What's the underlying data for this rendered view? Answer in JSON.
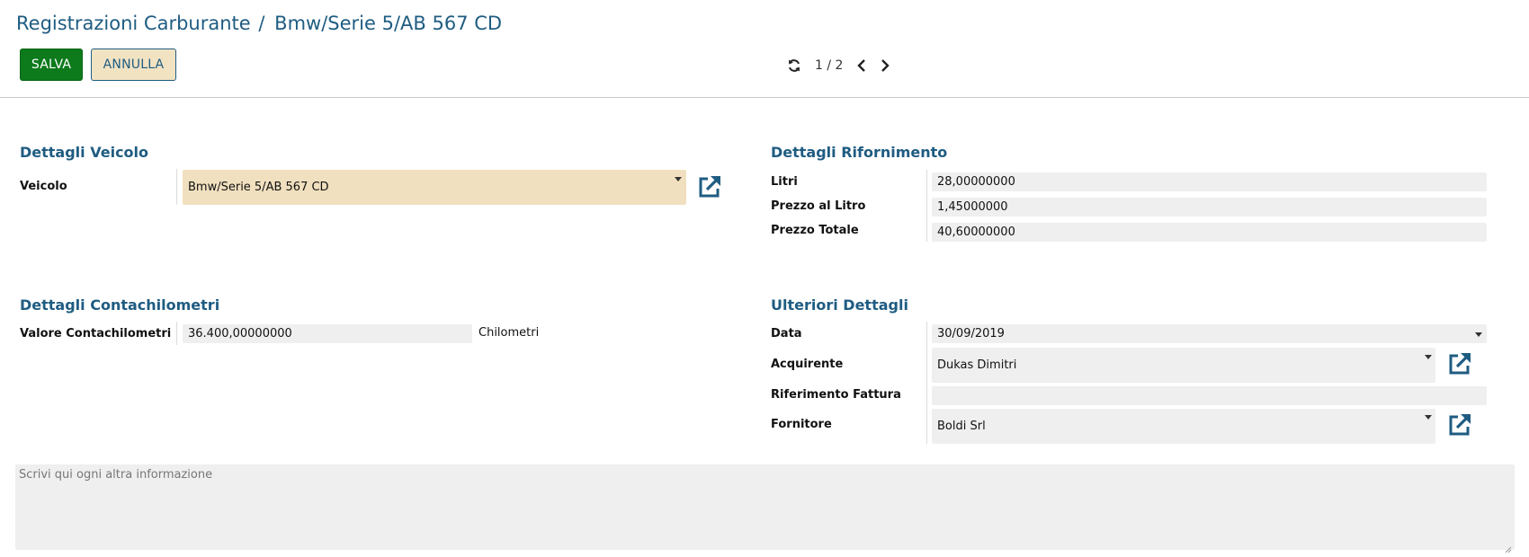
{
  "breadcrumb": {
    "parent": "Registrazioni Carburante",
    "separator": "/",
    "current": "Bmw/Serie 5/AB 567 CD"
  },
  "toolbar": {
    "save_label": "SALVA",
    "cancel_label": "ANNULLA"
  },
  "pager": {
    "value": "1 / 2"
  },
  "vehicle_section": {
    "title": "Dettagli Veicolo",
    "vehicle_label": "Veicolo",
    "vehicle_value": "Bmw/Serie 5/AB 567 CD"
  },
  "refuel_section": {
    "title": "Dettagli Rifornimento",
    "liters_label": "Litri",
    "liters_value": "28,00000000",
    "price_per_liter_label": "Prezzo al Litro",
    "price_per_liter_value": "1,45000000",
    "total_price_label": "Prezzo Totale",
    "total_price_value": "40,60000000"
  },
  "odometer_section": {
    "title": "Dettagli Contachilometri",
    "odometer_label": "Valore Contachilometri",
    "odometer_value": "36.400,00000000",
    "odometer_unit": "Chilometri"
  },
  "further_section": {
    "title": "Ulteriori Dettagli",
    "date_label": "Data",
    "date_value": "30/09/2019",
    "buyer_label": "Acquirente",
    "buyer_value": "Dukas Dimitri",
    "invoice_ref_label": "Riferimento Fattura",
    "invoice_ref_value": "",
    "vendor_label": "Fornitore",
    "vendor_value": "Boldi Srl"
  },
  "notes": {
    "placeholder": "Scrivi qui ogni altra informazione"
  },
  "colors": {
    "accent": "#1f5c82",
    "save_button": "#0d7a1c",
    "required_field": "#f1e0bf",
    "field_bg": "#efefef"
  }
}
